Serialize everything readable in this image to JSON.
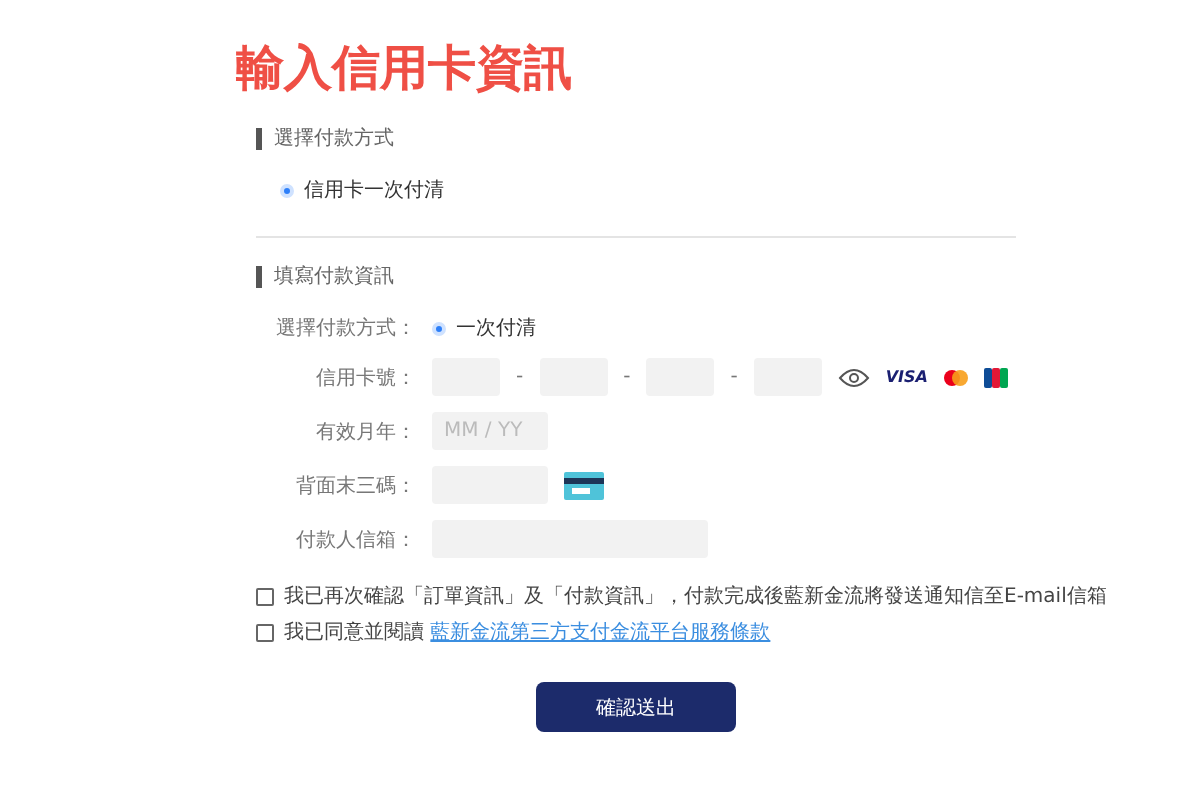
{
  "title": "輸入信用卡資訊",
  "method_section": {
    "heading": "選擇付款方式",
    "options": [
      {
        "label": "信用卡一次付清",
        "selected": true
      }
    ]
  },
  "details_section": {
    "heading": "填寫付款資訊",
    "payment_method": {
      "label": "選擇付款方式：",
      "options": [
        {
          "label": "一次付清",
          "selected": true
        }
      ]
    },
    "card_number": {
      "label": "信用卡號：",
      "separators": [
        "-",
        "-",
        "-"
      ],
      "brands": [
        "VISA"
      ]
    },
    "expiry": {
      "label": "有效月年：",
      "placeholder": "MM / YY"
    },
    "cvv": {
      "label": "背面末三碼："
    },
    "email": {
      "label": "付款人信箱："
    }
  },
  "agreements": [
    {
      "text": "我已再次確認「訂單資訊」及「付款資訊」，付款完成後藍新金流將發送通知信至E-mail信箱",
      "checked": false
    },
    {
      "text": "我已同意並閱讀",
      "link": "藍新金流第三方支付金流平台服務條款",
      "checked": false
    }
  ],
  "submit": "確認送出"
}
